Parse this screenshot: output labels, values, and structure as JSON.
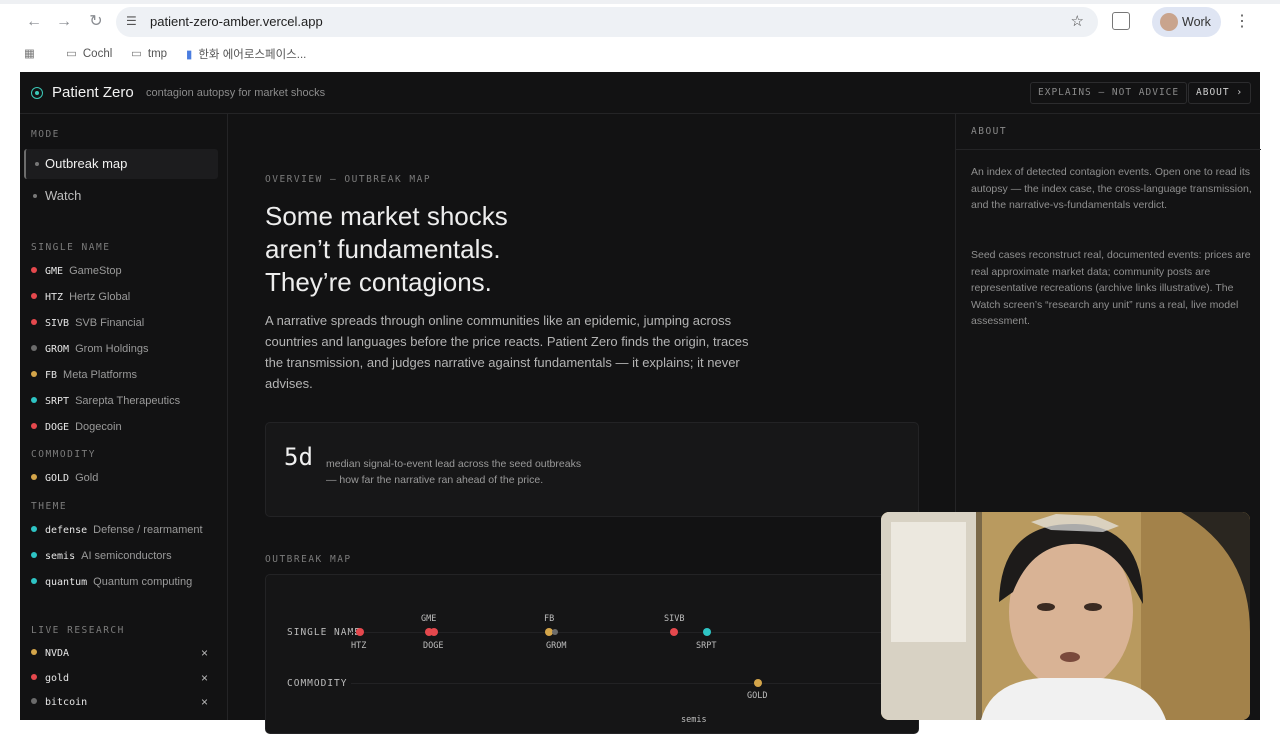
{
  "browser": {
    "url": "patient-zero-amber.vercel.app",
    "profile_label": "Work",
    "bookmarks": [
      "Cochl",
      "tmp",
      "한화 에어로스페이스..."
    ]
  },
  "app": {
    "brand": "Patient Zero",
    "tagline": "contagion autopsy for market shocks",
    "explains_pill": "EXPLAINS — NOT ADVICE",
    "about_pill": "ABOUT ›"
  },
  "sidebar": {
    "mode_title": "MODE",
    "modes": [
      "Outbreak map",
      "Watch"
    ],
    "single_title": "SINGLE NAME",
    "single": [
      {
        "ticker": "GME",
        "name": "GameStop",
        "color": "#e5484d"
      },
      {
        "ticker": "HTZ",
        "name": "Hertz Global",
        "color": "#e5484d"
      },
      {
        "ticker": "SIVB",
        "name": "SVB Financial",
        "color": "#e5484d"
      },
      {
        "ticker": "GROM",
        "name": "Grom Holdings",
        "color": "#6b6b6b"
      },
      {
        "ticker": "FB",
        "name": "Meta Platforms",
        "color": "#d4a54a"
      },
      {
        "ticker": "SRPT",
        "name": "Sarepta Therapeutics",
        "color": "#2ec4c4"
      },
      {
        "ticker": "DOGE",
        "name": "Dogecoin",
        "color": "#e5484d"
      }
    ],
    "commodity_title": "COMMODITY",
    "commodity": [
      {
        "ticker": "GOLD",
        "name": "Gold",
        "color": "#d4a54a"
      }
    ],
    "theme_title": "THEME",
    "theme": [
      {
        "ticker": "defense",
        "name": "Defense / rearmament",
        "color": "#2ec4c4"
      },
      {
        "ticker": "semis",
        "name": "AI semiconductors",
        "color": "#2ec4c4"
      },
      {
        "ticker": "quantum",
        "name": "Quantum computing",
        "color": "#2ec4c4"
      }
    ],
    "live_title": "LIVE RESEARCH",
    "live": [
      {
        "ticker": "NVDA",
        "color": "#d4a54a"
      },
      {
        "ticker": "gold",
        "color": "#e5484d"
      },
      {
        "ticker": "bitcoin",
        "color": "#6b6b6b"
      }
    ],
    "remove_glyph": "×"
  },
  "main": {
    "kicker": "OVERVIEW — OUTBREAK MAP",
    "headline_1": "Some market shocks",
    "headline_2": "aren’t fundamentals.",
    "headline_3": "They’re contagions.",
    "lede": "A narrative spreads through online communities like an epidemic, jumping across countries and languages before the price reacts. Patient Zero finds the origin, traces the transmission, and judges narrative against fundamentals — it explains; it never advises.",
    "stat_value": "5d",
    "stat_desc": "median signal-to-event lead across the seed outbreaks — how far the narrative ran ahead of the price.",
    "map_title": "OUTBREAK MAP",
    "map": {
      "lane_single": "SINGLE NAME",
      "lane_commodity": "COMMODITY",
      "labels": [
        "GME",
        "FB",
        "SIVB",
        "HTZ",
        "DOGE",
        "GROM",
        "SRPT",
        "GOLD",
        "semis"
      ]
    }
  },
  "aside": {
    "title": "ABOUT",
    "p1": "An index of detected contagion events. Open one to read its autopsy — the index case, the cross-language transmission, and the narrative-vs-fundamentals verdict.",
    "p2": "Seed cases reconstruct real, documented events: prices are real approximate market data; community posts are representative recreations (archive links illustrative). The Watch screen’s “research any unit” runs a real, live model assessment."
  }
}
